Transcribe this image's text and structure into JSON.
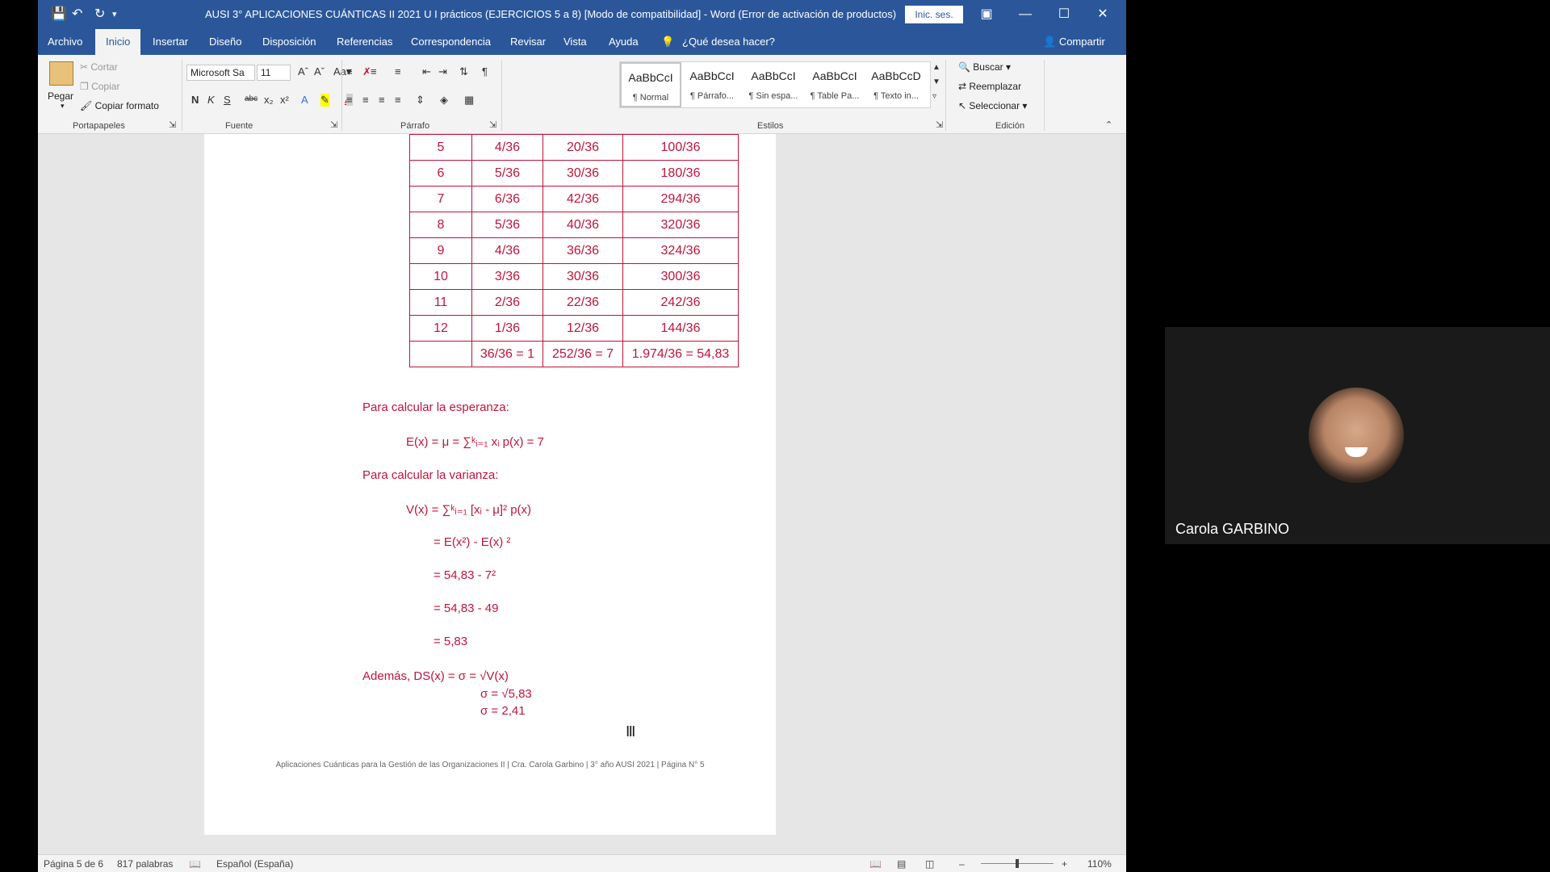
{
  "window": {
    "title": "AUSI 3° APLICACIONES CUÁNTICAS II 2021 U I prácticos (EJERCICIOS 5 a 8) [Modo de compatibilidad] - Word (Error de activación de productos)",
    "signin_label": "Inic. ses."
  },
  "menu": {
    "tabs": [
      "Archivo",
      "Inicio",
      "Insertar",
      "Diseño",
      "Disposición",
      "Referencias",
      "Correspondencia",
      "Revisar",
      "Vista",
      "Ayuda"
    ],
    "search_placeholder": "¿Qué desea hacer?",
    "share_label": "Compartir"
  },
  "ribbon": {
    "clipboard": {
      "paste": "Pegar",
      "cut": "Cortar",
      "copy": "Copiar",
      "format_painter": "Copiar formato",
      "label": "Portapapeles"
    },
    "font": {
      "font_name": "Microsoft Sa",
      "font_size": "11",
      "label": "Fuente"
    },
    "paragraph": {
      "label": "Párrafo"
    },
    "styles": {
      "label": "Estilos",
      "items": [
        {
          "sample": "AaBbCcI",
          "name": "¶ Normal"
        },
        {
          "sample": "AaBbCcI",
          "name": "¶ Párrafo..."
        },
        {
          "sample": "AaBbCcI",
          "name": "¶ Sin espa..."
        },
        {
          "sample": "AaBbCcI",
          "name": "¶ Table Pa..."
        },
        {
          "sample": "AaBbCcD",
          "name": "¶ Texto in..."
        }
      ]
    },
    "editing": {
      "label": "Edición",
      "find": "Buscar",
      "replace": "Reemplazar",
      "select": "Seleccionar"
    }
  },
  "document": {
    "table_rows": [
      [
        "5",
        "4/36",
        "20/36",
        "100/36"
      ],
      [
        "6",
        "5/36",
        "30/36",
        "180/36"
      ],
      [
        "7",
        "6/36",
        "42/36",
        "294/36"
      ],
      [
        "8",
        "5/36",
        "40/36",
        "320/36"
      ],
      [
        "9",
        "4/36",
        "36/36",
        "324/36"
      ],
      [
        "10",
        "3/36",
        "30/36",
        "300/36"
      ],
      [
        "11",
        "2/36",
        "22/36",
        "242/36"
      ],
      [
        "12",
        "1/36",
        "12/36",
        "144/36"
      ],
      [
        "",
        "36/36 = 1",
        "252/36 = 7",
        "1.974/36 = 54,83"
      ]
    ],
    "expectation_heading": "Para calcular la esperanza:",
    "expectation_formula": "E(x) = μ = ∑ᵏᵢ₌₁ xᵢ p(x) = 7",
    "variance_heading": "Para calcular la varianza:",
    "variance_lines": [
      "V(x) = ∑ᵏᵢ₌₁ [xᵢ - μ]² p(x)",
      "= E(x²) - E(x) ²",
      "= 54,83 - 7²",
      "= 54,83 - 49",
      "= 5,83"
    ],
    "sd_lines": [
      "Además, DS(x) = σ = √V(x)",
      "σ =  √5,83",
      "σ = 2,41"
    ],
    "footer": "Aplicaciones Cuánticas para la Gestión de las Organizaciones II | Cra. Carola Garbino | 3° año AUSI 2021 | Página N° 5"
  },
  "status": {
    "page": "Página 5 de 6",
    "words": "817 palabras",
    "language": "Español (España)",
    "zoom": "110%"
  },
  "participant": {
    "name": "Carola GARBINO"
  },
  "colors": {
    "accent": "#2b579a",
    "doc_text": "#c0143c"
  }
}
